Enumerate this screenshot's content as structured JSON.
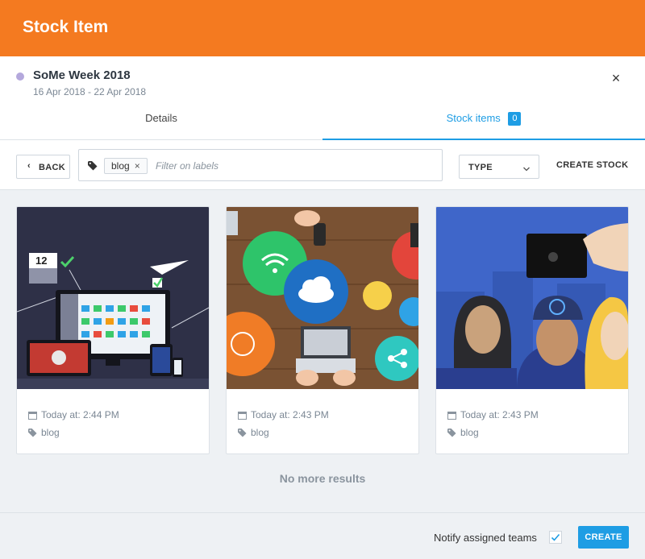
{
  "header": {
    "title": "Stock Item"
  },
  "campaign": {
    "name": "SoMe Week 2018",
    "dates": "16 Apr 2018 - 22 Apr 2018",
    "dot_color": "#b4a8dc",
    "close_icon": "×"
  },
  "tabs": [
    {
      "label": "Details",
      "active": false
    },
    {
      "label": "Stock items",
      "count": "0",
      "active": true
    }
  ],
  "toolbar": {
    "back_label": "BACK",
    "back_icon": "‹",
    "filter_chip": "blog",
    "filter_chip_remove": "×",
    "filter_placeholder": "Filter on labels",
    "type_label": "TYPE",
    "create_stock_label": "CREATE STOCK"
  },
  "cards": [
    {
      "image": "dashboard-devices-illustration",
      "date": "Today at: 2:44 PM",
      "tag": "blog"
    },
    {
      "image": "social-media-desk-illustration",
      "date": "Today at: 2:43 PM",
      "tag": "blog"
    },
    {
      "image": "group-selfie-illustration",
      "date": "Today at: 2:43 PM",
      "tag": "blog"
    }
  ],
  "no_more_results": "No more results",
  "footer": {
    "notify_label": "Notify assigned teams",
    "notify_checked": true,
    "create_label": "CREATE"
  },
  "colors": {
    "header": "#f47a20",
    "accent": "#1e9de4",
    "muted": "#7b8794"
  }
}
